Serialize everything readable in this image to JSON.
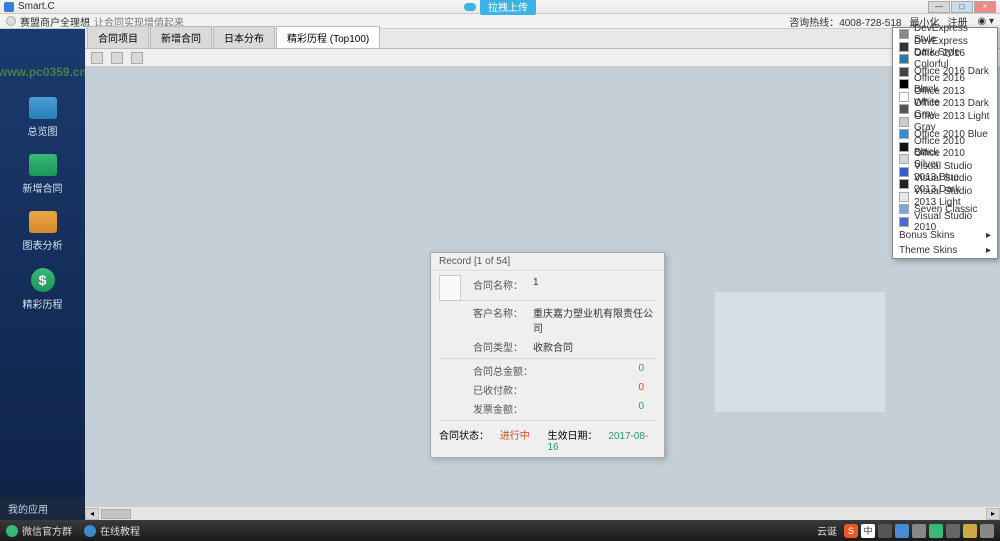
{
  "titlebar": {
    "title": "Smart.C",
    "cloud_button": "拉拽上传"
  },
  "header": {
    "app_name": "赛盟商户全理想",
    "subtitle": "让合同实现增值起来",
    "hotline_label": "咨询热线：",
    "hotline": "4008-728-518",
    "minimize": "最小化",
    "register": "注册"
  },
  "sidebar": {
    "items": [
      {
        "label": "总览图"
      },
      {
        "label": "新增合同"
      },
      {
        "label": "图表分析"
      },
      {
        "label": "精彩历程"
      }
    ],
    "bottom": "我的应用"
  },
  "tabs": [
    {
      "label": "合同项目"
    },
    {
      "label": "新增合同"
    },
    {
      "label": "日本分布"
    },
    {
      "label": "精彩历程 (Top100)",
      "active": true
    }
  ],
  "record": {
    "title": "Record [1 of 54]",
    "contract_name_label": "合同名称：",
    "contract_name_value": "1",
    "customer_label": "客户名称：",
    "customer_value": "重庆嘉力塑业机有限责任公司",
    "contract_type_label": "合同类型：",
    "contract_type_value": "收款合同",
    "total_amount_label": "合同总金额：",
    "total_amount_value": "0",
    "received_label": "已收付款：",
    "received_value": "0",
    "invoice_label": "发票金额：",
    "invoice_value": "0",
    "status_label": "合同状态：",
    "status_value": "进行中",
    "date_label": "生效日期：",
    "date_value": "2017-08-16"
  },
  "theme_menu": {
    "items": [
      {
        "label": "DevExpress Style",
        "color": "#888"
      },
      {
        "label": "DevExpress Dark Style",
        "color": "#333"
      },
      {
        "label": "Office 2016 Colorful",
        "color": "#2a7ab0"
      },
      {
        "label": "Office 2016 Dark",
        "color": "#444"
      },
      {
        "label": "Office 2016 Black",
        "color": "#000"
      },
      {
        "label": "Office 2013 White",
        "color": "#fff"
      },
      {
        "label": "Office 2013 Dark Gray",
        "color": "#555"
      },
      {
        "label": "Office 2013 Light Gray",
        "color": "#ccc"
      },
      {
        "label": "Office 2010 Blue",
        "color": "#3a8ad0"
      },
      {
        "label": "Office 2010 Black",
        "color": "#111"
      },
      {
        "label": "Office 2010 Silver",
        "color": "#d5d5d5"
      },
      {
        "label": "Visual Studio 2013 Blue",
        "color": "#3a5ad0"
      },
      {
        "label": "Visual Studio 2013 Dark",
        "color": "#222"
      },
      {
        "label": "Visual Studio 2013 Light",
        "color": "#e5e5f0"
      },
      {
        "label": "Seven Classic",
        "color": "#7aaad0"
      },
      {
        "label": "Visual Studio 2010",
        "color": "#4a6ad0"
      }
    ],
    "bonus": "Bonus Skins",
    "theme": "Theme Skins"
  },
  "taskbar": {
    "wechat": "微信官方群",
    "tutorial": "在线教程",
    "cloud": "云诞",
    "ime": "中"
  },
  "watermark": "www.pc0359.cn"
}
